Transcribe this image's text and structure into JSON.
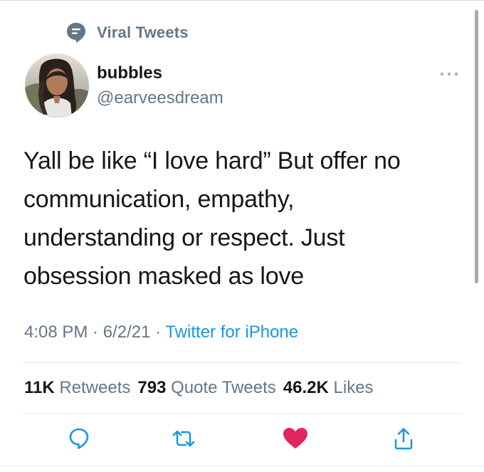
{
  "context": {
    "icon": "speech-bubble-icon",
    "label": "Viral Tweets"
  },
  "author": {
    "display_name": "bubbles",
    "handle": "@earveesdream",
    "avatar": "avatar-photo"
  },
  "more_icon": "more-dots-icon",
  "tweet": {
    "lines": [
      "Yall be like “I love hard” But offer no",
      "communication, empathy,",
      "understanding or respect. Just",
      "obsession masked as love"
    ]
  },
  "meta": {
    "time": "4:08 PM",
    "separator1": " · ",
    "date": "6/2/21",
    "separator2": " · ",
    "source": "Twitter for iPhone"
  },
  "stats": {
    "retweets_count": "11K",
    "retweets_label": "Retweets",
    "quotes_count": "793",
    "quotes_label": "Quote Tweets",
    "likes_count": "46.2K",
    "likes_label": "Likes"
  },
  "actions": {
    "reply_icon": "reply-icon",
    "retweet_icon": "retweet-icon",
    "like_icon": "heart-icon",
    "share_icon": "share-icon"
  },
  "colors": {
    "primary_text": "#14171a",
    "secondary_text": "#657786",
    "link": "#1b95e0",
    "like": "#e0245e"
  }
}
